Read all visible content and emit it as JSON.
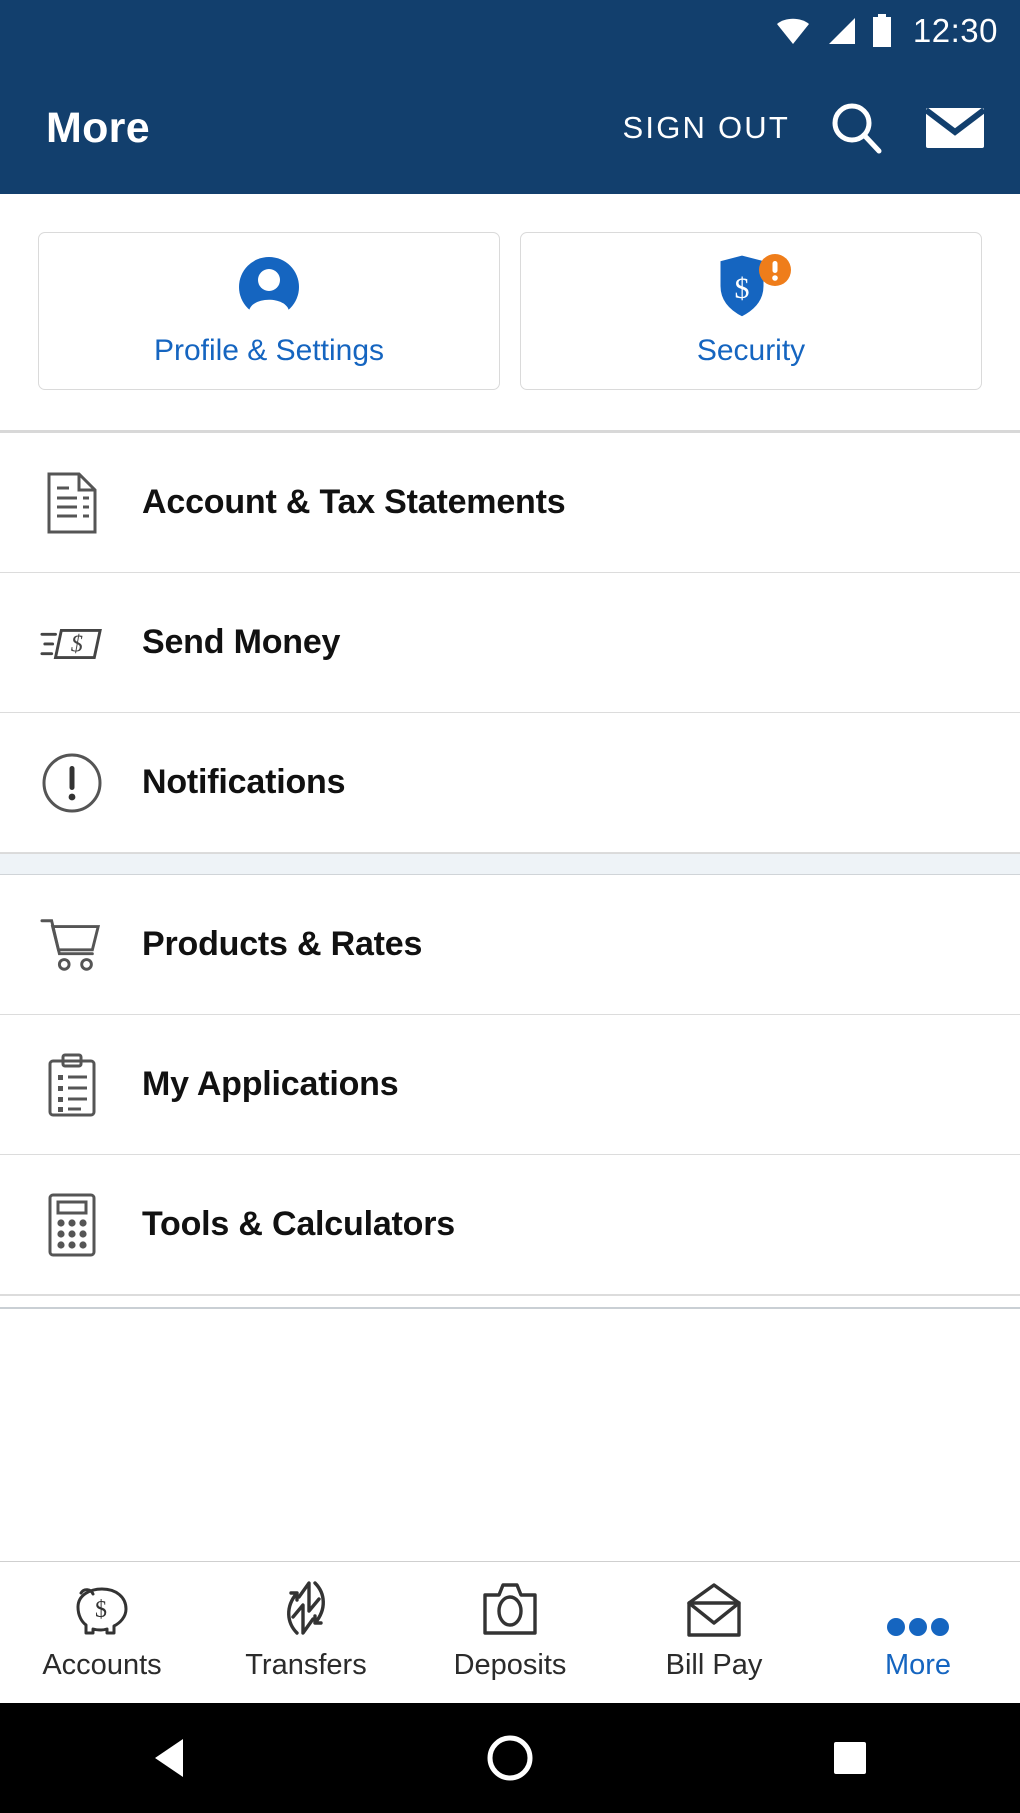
{
  "statusbar": {
    "time": "12:30",
    "icons": [
      "wifi-icon",
      "cellular-signal-icon",
      "battery-icon"
    ]
  },
  "appbar": {
    "title": "More",
    "sign_out_label": "SIGN OUT",
    "search_icon": "search-icon",
    "messages_icon": "envelope-icon",
    "background_color": "#123F6D"
  },
  "cards": [
    {
      "label": "Profile & Settings",
      "icon": "person-circle-icon",
      "badge": null
    },
    {
      "label": "Security",
      "icon": "shield-dollar-icon",
      "badge": "alert-badge"
    }
  ],
  "menu_groups": [
    {
      "items": [
        {
          "label": "Account & Tax Statements",
          "icon": "document-icon"
        },
        {
          "label": "Send Money",
          "icon": "money-send-icon"
        },
        {
          "label": "Notifications",
          "icon": "alert-circle-icon"
        }
      ]
    },
    {
      "items": [
        {
          "label": "Products & Rates",
          "icon": "shopping-cart-icon"
        },
        {
          "label": "My Applications",
          "icon": "clipboard-icon"
        },
        {
          "label": "Tools & Calculators",
          "icon": "calculator-icon"
        }
      ]
    }
  ],
  "bottom_nav": {
    "items": [
      {
        "label": "Accounts",
        "icon": "piggy-bank-icon",
        "active": false
      },
      {
        "label": "Transfers",
        "icon": "transfer-arrows-icon",
        "active": false
      },
      {
        "label": "Deposits",
        "icon": "camera-icon",
        "active": false
      },
      {
        "label": "Bill Pay",
        "icon": "open-envelope-icon",
        "active": false
      },
      {
        "label": "More",
        "icon": "more-dots-icon",
        "active": true
      }
    ],
    "active_color": "#1565C0"
  },
  "android_nav": {
    "back": "back-triangle-icon",
    "home": "home-circle-icon",
    "recents": "recents-square-icon"
  },
  "colors": {
    "brand_navy": "#123F6D",
    "link_blue": "#1565C0",
    "alert_orange": "#EF7D1A"
  }
}
